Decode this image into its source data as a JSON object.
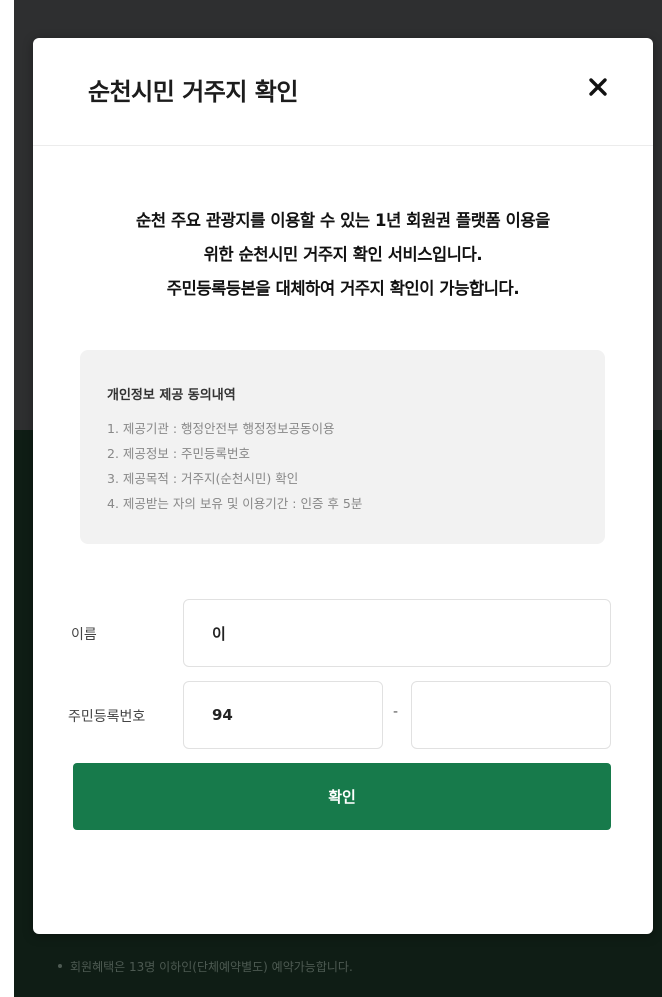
{
  "modal": {
    "title": "순천시민 거주지 확인",
    "close_icon": "close-icon"
  },
  "intro": {
    "lines": [
      "순천 주요 관광지를 이용할 수 있는 1년 회원권 플랫폼 이용을",
      "위한 순천시민 거주지 확인 서비스입니다.",
      "주민등록등본을 대체하여 거주지 확인이 가능합니다."
    ]
  },
  "consent": {
    "title": "개인정보 제공 동의내역",
    "items": [
      "1. 제공기관 : 행정안전부 행정정보공동이용",
      "2. 제공정보 : 주민등록번호",
      "3. 제공목적 : 거주지(순천시민) 확인",
      "4. 제공받는 자의 보유 및 이용기간 : 인증 후 5분"
    ]
  },
  "form": {
    "name_label": "이름",
    "name_value": "이",
    "rrn_label": "주민등록번호",
    "rrn_front_value": "94",
    "rrn_separator": "-",
    "rrn_back_value": ""
  },
  "confirm_label": "확인",
  "background": {
    "footnote": "회원혜택은 13명 이하인(단체예약별도) 예약가능합니다."
  },
  "colors": {
    "primary_green": "#177a4b",
    "backdrop": "#2e2f30",
    "consent_bg": "#f2f2f2"
  }
}
